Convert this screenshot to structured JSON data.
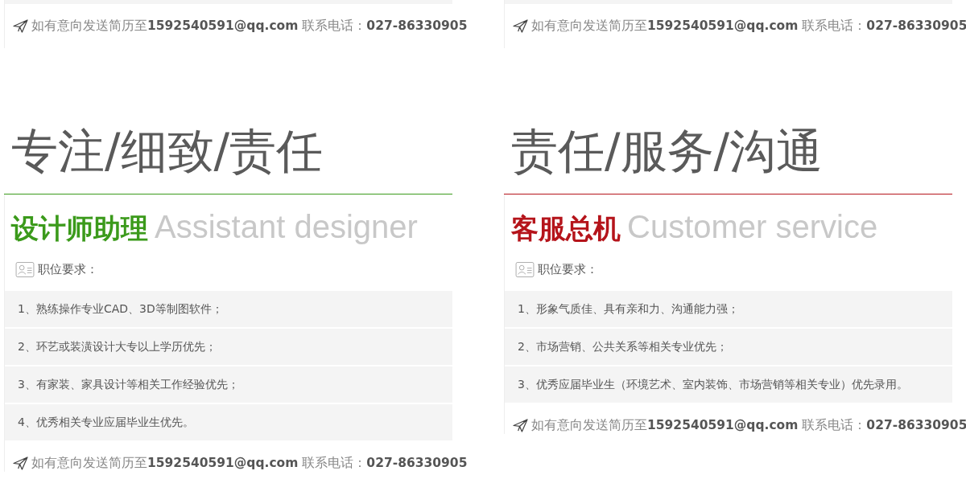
{
  "columns": [
    {
      "top_contact": "如有意向发送简历至**1592540591@qq.com** 联系电话：**027-86330905**",
      "motto": "专注/细致/责任",
      "color": "#3b9a1b",
      "title_cn": "设计师助理",
      "title_en": "Assistant designer",
      "requirements_label": "职位要求：",
      "requirements": [
        "1、熟练操作专业CAD、3D等制图软件；",
        "2、环艺或装潢设计大专以上学历优先；",
        "3、有家装、家具设计等相关工作经验优先；",
        "4、优秀相关专业应届毕业生优先。"
      ],
      "contact": "如有意向发送简历至**1592540591@qq.com** 联系电话：**027-86330905**"
    },
    {
      "top_contact": "如有意向发送简历至**1592540591@qq.com** 联系电话：**027-86330905**",
      "motto": "责任/服务/沟通",
      "color": "#b5141b",
      "title_cn": "客服总机",
      "title_en": "Customer service",
      "requirements_label": "职位要求：",
      "requirements": [
        "1、形象气质佳、具有亲和力、沟通能力强；",
        "2、市场营销、公共关系等相关专业优先；",
        "3、优秀应届毕业生（环境艺术、室内装饰、市场营销等相关专业）优先录用。"
      ],
      "contact": "如有意向发送简历至**1592540591@qq.com** 联系电话：**027-86330905**"
    }
  ]
}
